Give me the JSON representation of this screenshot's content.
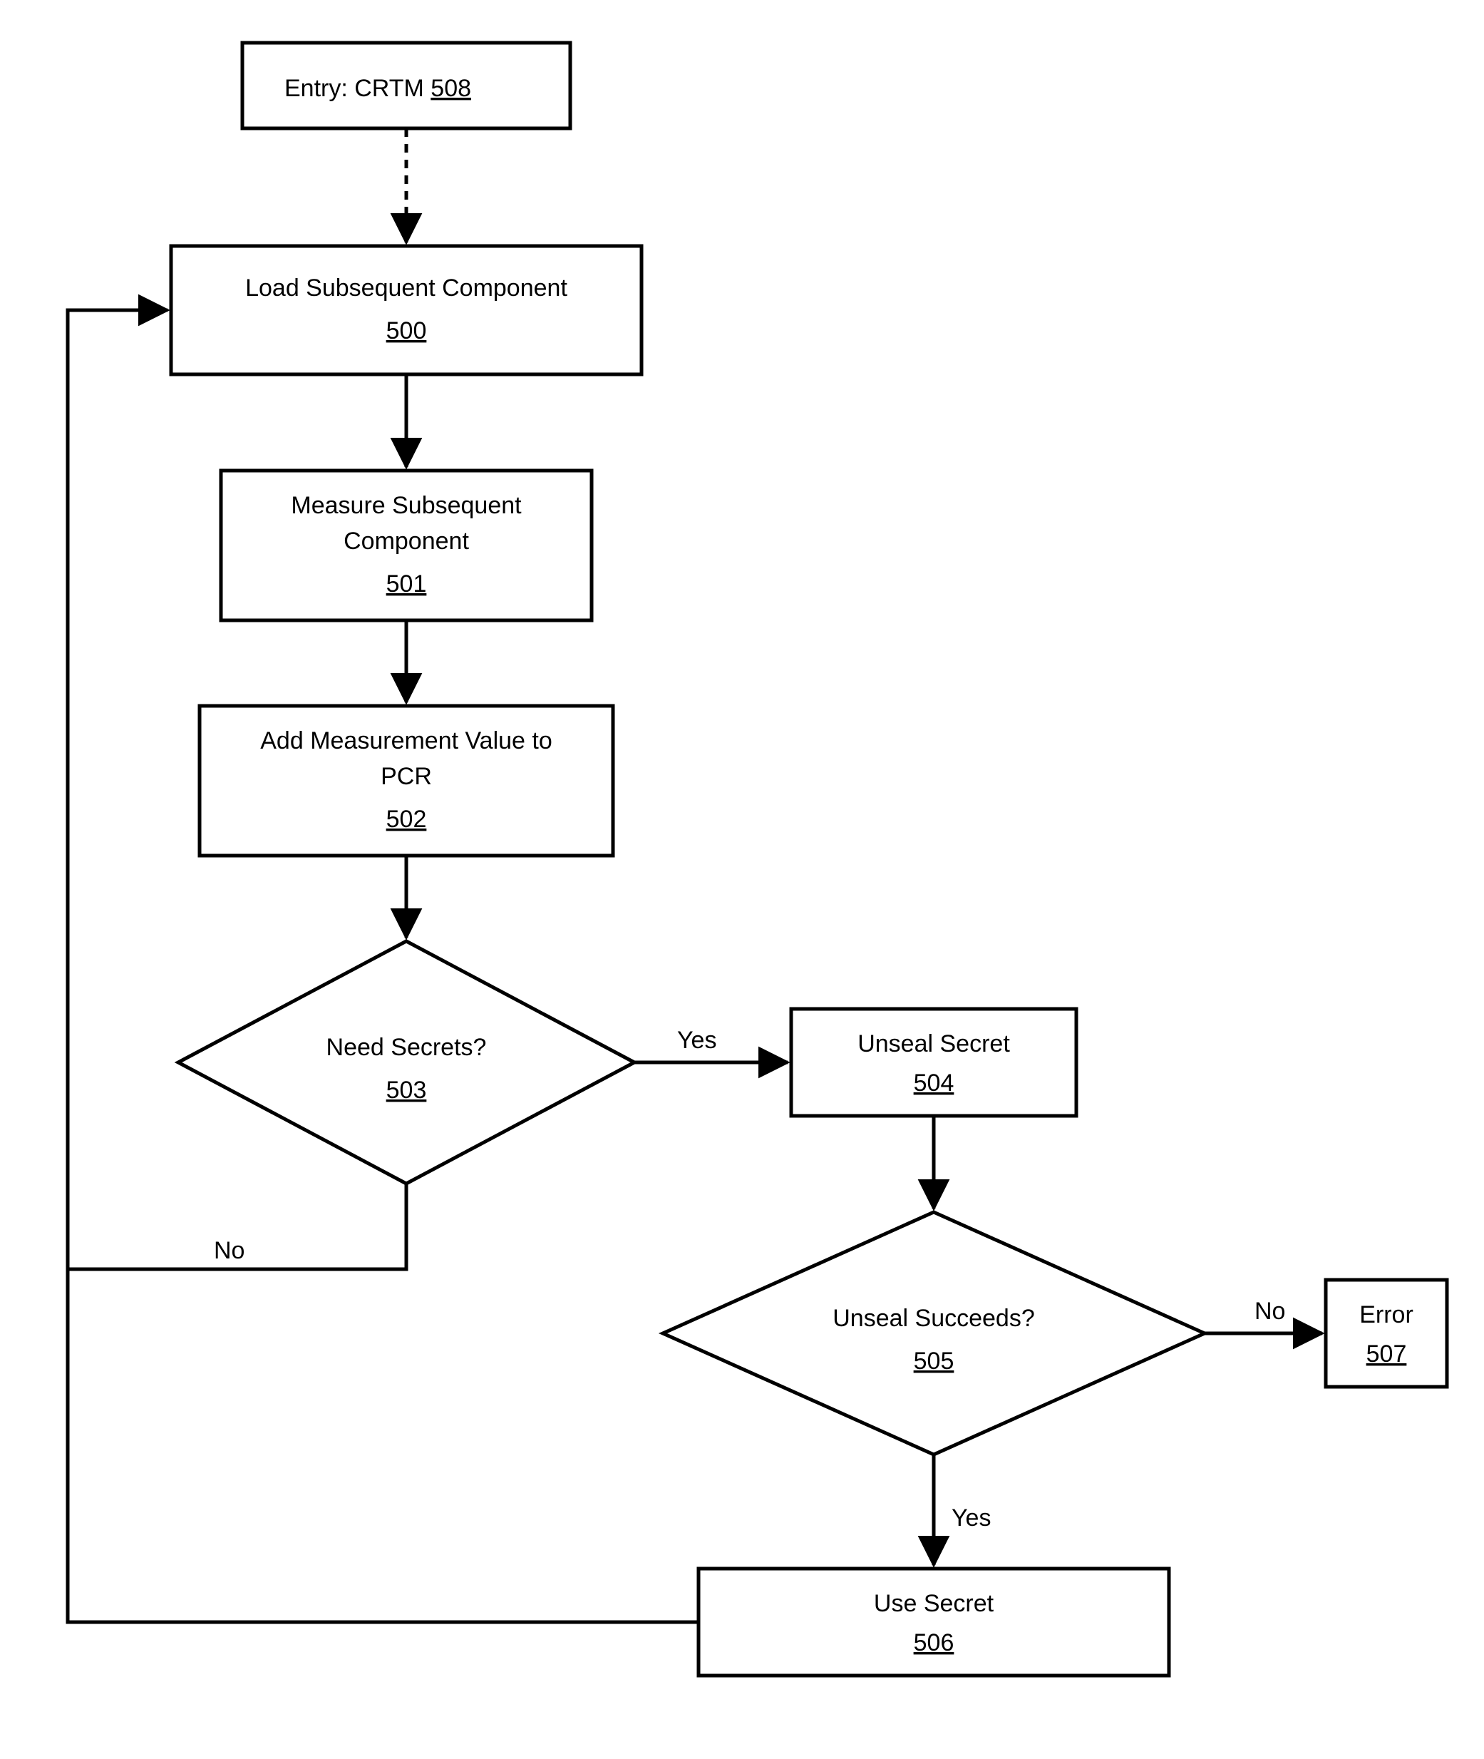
{
  "chart_data": {
    "type": "flowchart",
    "nodes": [
      {
        "id": "508",
        "shape": "rect",
        "label": "Entry: CRTM",
        "ref": "508"
      },
      {
        "id": "500",
        "shape": "rect",
        "label": "Load Subsequent Component",
        "ref": "500"
      },
      {
        "id": "501",
        "shape": "rect",
        "label": "Measure Subsequent Component",
        "ref": "501"
      },
      {
        "id": "502",
        "shape": "rect",
        "label": "Add Measurement Value to PCR",
        "ref": "502"
      },
      {
        "id": "503",
        "shape": "diamond",
        "label": "Need Secrets?",
        "ref": "503"
      },
      {
        "id": "504",
        "shape": "rect",
        "label": "Unseal Secret",
        "ref": "504"
      },
      {
        "id": "505",
        "shape": "diamond",
        "label": "Unseal Succeeds?",
        "ref": "505"
      },
      {
        "id": "506",
        "shape": "rect",
        "label": "Use Secret",
        "ref": "506"
      },
      {
        "id": "507",
        "shape": "rect",
        "label": "Error",
        "ref": "507"
      }
    ],
    "edges": [
      {
        "from": "508",
        "to": "500",
        "label": "",
        "style": "dashed"
      },
      {
        "from": "500",
        "to": "501",
        "label": ""
      },
      {
        "from": "501",
        "to": "502",
        "label": ""
      },
      {
        "from": "502",
        "to": "503",
        "label": ""
      },
      {
        "from": "503",
        "to": "504",
        "label": "Yes"
      },
      {
        "from": "503",
        "to": "500",
        "label": "No"
      },
      {
        "from": "504",
        "to": "505",
        "label": ""
      },
      {
        "from": "505",
        "to": "507",
        "label": "No"
      },
      {
        "from": "505",
        "to": "506",
        "label": "Yes"
      },
      {
        "from": "506",
        "to": "500",
        "label": ""
      }
    ]
  },
  "labels": {
    "n508_text": "Entry: CRTM",
    "n508_ref": "508",
    "n500_text": "Load Subsequent Component",
    "n500_ref": "500",
    "n501_line1": "Measure Subsequent",
    "n501_line2": "Component",
    "n501_ref": "501",
    "n502_line1": "Add Measurement Value to",
    "n502_line2": "PCR",
    "n502_ref": "502",
    "n503_text": "Need Secrets?",
    "n503_ref": "503",
    "n504_text": "Unseal Secret",
    "n504_ref": "504",
    "n505_text": "Unseal Succeeds?",
    "n505_ref": "505",
    "n506_text": "Use Secret",
    "n506_ref": "506",
    "n507_text": "Error",
    "n507_ref": "507",
    "edge_503_504": "Yes",
    "edge_503_500": "No",
    "edge_505_507": "No",
    "edge_505_506": "Yes"
  }
}
